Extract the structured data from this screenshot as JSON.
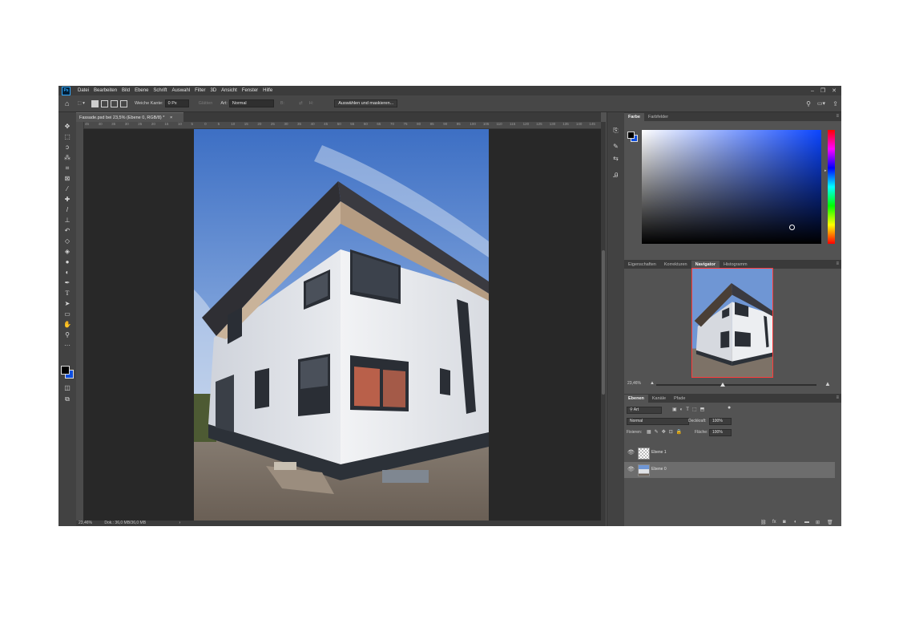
{
  "menubar": {
    "logo": "Ps",
    "items": [
      "Datei",
      "Bearbeiten",
      "Bild",
      "Ebene",
      "Schrift",
      "Auswahl",
      "Filter",
      "3D",
      "Ansicht",
      "Fenster",
      "Hilfe"
    ],
    "window_controls": [
      "–",
      "❐",
      "✕"
    ]
  },
  "options": {
    "feather_label": "Weiche Kante:",
    "feather_value": "0 Px",
    "antialias_label": "Glätten",
    "style_label": "Art:",
    "style_value": "Normal",
    "width_label": "B:",
    "height_label": "H:",
    "select_mask_button": "Auswählen und maskieren..."
  },
  "document": {
    "tab_title": "Fassade.psd bei 23,5% (Ebene 0, RGB/8) *",
    "tab_close": "×",
    "ruler_h_ticks": [
      "45",
      "40",
      "35",
      "30",
      "25",
      "20",
      "15",
      "10",
      "5",
      "0",
      "5",
      "10",
      "15",
      "20",
      "25",
      "30",
      "35",
      "40",
      "45",
      "50",
      "55",
      "60",
      "65",
      "70",
      "75",
      "80",
      "85",
      "90",
      "95",
      "100",
      "105",
      "110",
      "115",
      "120",
      "125",
      "130",
      "135",
      "140",
      "145"
    ],
    "status_zoom": "23,46%",
    "status_doc": "Dok.: 36,0 MB/36,0 MB"
  },
  "panels": {
    "color_tabs": [
      "Farbe",
      "Farbfelder"
    ],
    "nav_tabs": [
      "Eigenschaften",
      "Korrekturen",
      "Navigator",
      "Histogramm"
    ],
    "nav_active": "Navigator",
    "nav_zoom": "23,46%",
    "layer_tabs": [
      "Ebenen",
      "Kanäle",
      "Pfade"
    ],
    "layer_kind": "Art",
    "blend_mode": "Normal",
    "opacity_label": "Deckkraft:",
    "opacity_value": "100%",
    "lock_label": "Fixieren:",
    "fill_label": "Fläche:",
    "fill_value": "100%",
    "layers": [
      {
        "name": "Ebene 1",
        "selected": false
      },
      {
        "name": "Ebene 0",
        "selected": true
      }
    ],
    "footer_icons": [
      "link-icon",
      "fx-icon",
      "mask-icon",
      "adjustment-icon",
      "group-icon",
      "new-layer-icon",
      "trash-icon"
    ]
  },
  "colors": {
    "foreground": "#000000",
    "background": "#0e4fe0",
    "picker_hue": "#0b45ff"
  }
}
